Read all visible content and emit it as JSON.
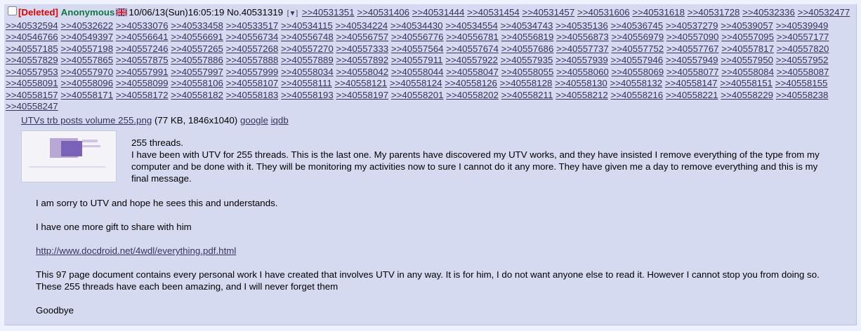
{
  "post": {
    "deleted_label": "[Deleted]",
    "name": "Anonymous",
    "datetime": "10/06/13(Sun)16:05:19",
    "number_label": "No.40531319",
    "menu_label": "[▼]",
    "flag_icon": "uk-flag-icon",
    "colors": {
      "background": "#d6daf0",
      "page": "#eef2ff",
      "deleted": "#dd0000",
      "name": "#117743",
      "link": "#34345c"
    },
    "quotelinks_line1": [
      ">>40531351",
      ">>40531406",
      ">>40531444",
      ">>40531454",
      ">>40531457",
      ">>40531606",
      ">>40531618",
      ">>40531728"
    ],
    "quotelinks_rest": [
      ">>40532336",
      ">>40532477",
      ">>40532594",
      ">>40532622",
      ">>40533076",
      ">>40533458",
      ">>40533517",
      ">>40534115",
      ">>40534224",
      ">>40534430",
      ">>40534554",
      ">>40534743",
      ">>40535136",
      ">>40536745",
      ">>40537279",
      ">>40539057",
      ">>40539949",
      ">>40546766",
      ">>40549397",
      ">>40556641",
      ">>40556691",
      ">>40556734",
      ">>40556748",
      ">>40556757",
      ">>40556776",
      ">>40556781",
      ">>40556819",
      ">>40556873",
      ">>40556979",
      ">>40557090",
      ">>40557095",
      ">>40557177",
      ">>40557185",
      ">>40557198",
      ">>40557246",
      ">>40557265",
      ">>40557268",
      ">>40557270",
      ">>40557333",
      ">>40557564",
      ">>40557674",
      ">>40557686",
      ">>40557737",
      ">>40557752",
      ">>40557767",
      ">>40557817",
      ">>40557820",
      ">>40557829",
      ">>40557865",
      ">>40557875",
      ">>40557886",
      ">>40557888",
      ">>40557889",
      ">>40557892",
      ">>40557911",
      ">>40557922",
      ">>40557935",
      ">>40557939",
      ">>40557946",
      ">>40557949",
      ">>40557950",
      ">>40557952",
      ">>40557953",
      ">>40557970",
      ">>40557991",
      ">>40557997",
      ">>40557999",
      ">>40558034",
      ">>40558042",
      ">>40558044",
      ">>40558047",
      ">>40558055",
      ">>40558060",
      ">>40558069",
      ">>40558077",
      ">>40558084",
      ">>40558087",
      ">>40558091",
      ">>40558096",
      ">>40558099",
      ">>40558106",
      ">>40558107",
      ">>40558111",
      ">>40558121",
      ">>40558124",
      ">>40558126",
      ">>40558128",
      ">>40558130",
      ">>40558132",
      ">>40558147",
      ">>40558151",
      ">>40558155",
      ">>40558157",
      ">>40558171",
      ">>40558172",
      ">>40558182",
      ">>40558183",
      ">>40558193",
      ">>40558197",
      ">>40558201",
      ">>40558202",
      ">>40558211",
      ">>40558212",
      ">>40558216",
      ">>40558221",
      ">>40558229",
      ">>40558238",
      ">>40558247"
    ],
    "file": {
      "name": "UTVs trb posts volume 255.png",
      "meta": "(77 KB, 1846x1040)",
      "google_label": "google",
      "iqdb_label": "iqdb"
    },
    "message": {
      "line1": "255 threads.",
      "para1": "I have been with UTV for 255 threads. This is the last one. My parents have discovered my UTV works, and they have insisted I remove everything of the type from my computer and be done with it. They will be monitoring my activities now to sure I cannot do it any more. They have given me a day to remove everything and this is my final message.",
      "para2": "I am sorry to UTV and hope he sees this and understands.",
      "para3": "I have one more gift to share with him",
      "link": "http://www.docdroid.net/4wdl/everything.pdf.html",
      "para4": "This 97 page document contains every personal work I have created that involves UTV in any way. It is for him, I do not want anyone else to read it. However I cannot stop you from doing so. These 255 threads have each been amazing, and I will never forget them",
      "para5": "Goodbye"
    }
  }
}
